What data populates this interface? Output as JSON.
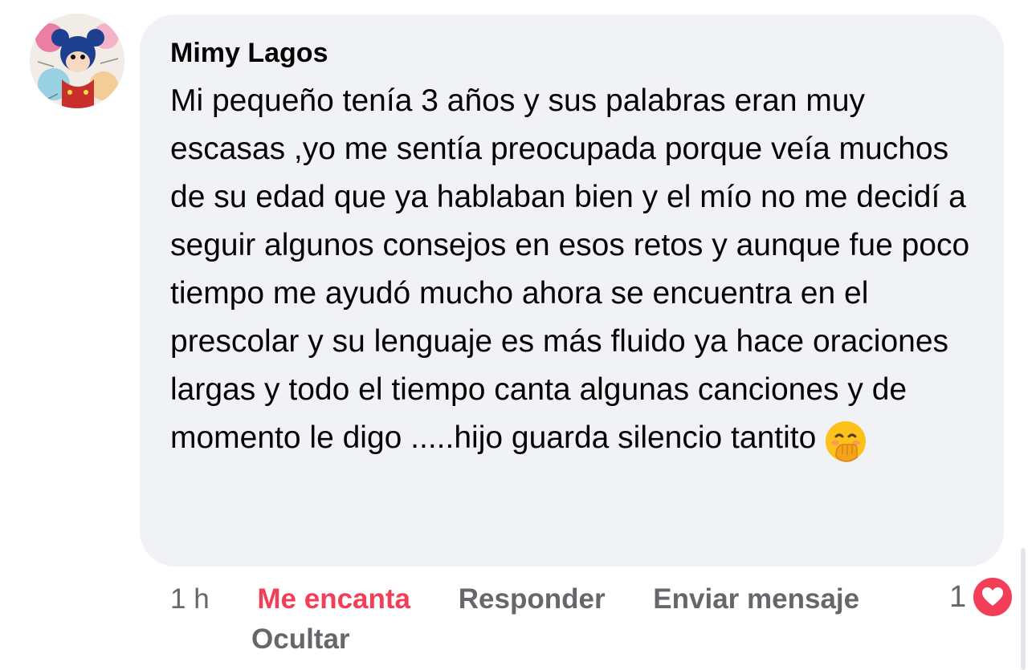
{
  "comment": {
    "author": "Mimy Lagos",
    "text": "Mi pequeño tenía 3 años y sus palabras eran muy escasas ,yo me sentía preocupada porque veía muchos de su edad que ya hablaban bien y el mío no me decidí a seguir algunos consejos en esos retos y aunque fue poco tiempo me ayudó mucho ahora se encuentra en el prescolar y su lenguaje es más fluido ya hace oraciones largas y todo el tiempo canta algunas canciones y de momento le digo .....hijo guarda silencio tantito",
    "emoji": "hand-over-mouth-emoji"
  },
  "actions": {
    "time": "1 h",
    "like_label": "Me encanta",
    "reply_label": "Responder",
    "send_message_label": "Enviar mensaje",
    "hide_label": "Ocultar"
  },
  "reactions": {
    "count": "1",
    "type": "heart-icon"
  },
  "colors": {
    "bubble": "#f0f2f5",
    "love": "#f33e58",
    "secondary_text": "#65676b"
  }
}
